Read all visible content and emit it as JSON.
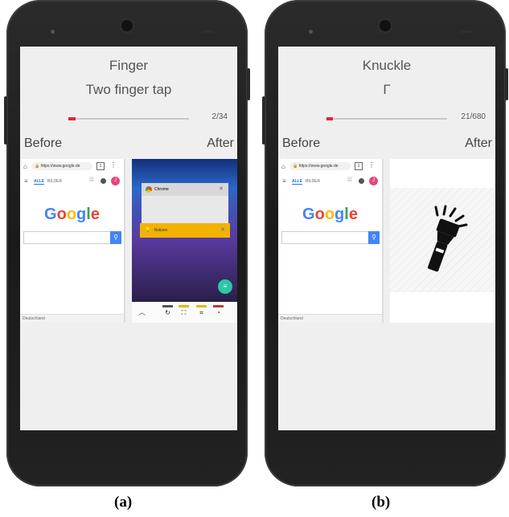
{
  "screens": [
    {
      "mode": "Finger",
      "gesture": "Two finger tap",
      "progress_text": "2/34",
      "progress_fraction": 0.06,
      "before_label": "Before",
      "after_label": "After",
      "caption": "(a)"
    },
    {
      "mode": "Knuckle",
      "gesture": "Γ",
      "progress_text": "21/680",
      "progress_fraction": 0.03,
      "before_label": "Before",
      "after_label": "After",
      "caption": "(b)"
    }
  ],
  "browser": {
    "url": "https://www.google.de",
    "tab_count": "1",
    "nav_all": "ALLE",
    "nav_images": "BILDER",
    "logo": [
      "G",
      "o",
      "o",
      "g",
      "l",
      "e"
    ],
    "avatar_letter": "J",
    "country": "Deutschland"
  },
  "recents": {
    "card_chrome": "Chrome",
    "card_notes": "Notizen"
  },
  "colors": {
    "progress": "#e0253c",
    "accent_blue": "#4285f4",
    "notes_card": "#f2b300",
    "fab": "#2bc7a5"
  }
}
